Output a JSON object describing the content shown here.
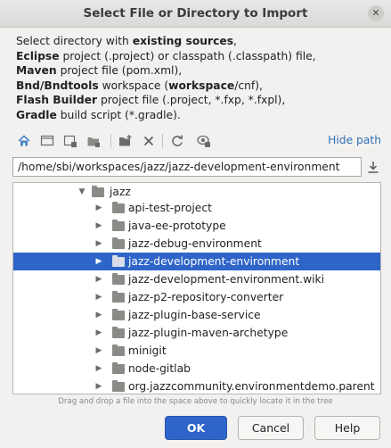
{
  "dialog": {
    "title": "Select File or Directory to Import"
  },
  "description": {
    "line1": {
      "pre": "Select directory with ",
      "bold": "existing sources",
      "post": ","
    },
    "line2": {
      "bold": "Eclipse",
      "post": " project (.project) or classpath (.classpath) file,"
    },
    "line3": {
      "bold": "Maven",
      "post": " project file (pom.xml),"
    },
    "line4": {
      "bold": "Bnd/Bndtools",
      "mid": " workspace (",
      "bold2": "workspace",
      "post": "/cnf),"
    },
    "line5": {
      "bold": "Flash Builder",
      "post": " project file (.project, *.fxp, *.fxpl),"
    },
    "line6": {
      "bold": "Gradle",
      "post": " build script (*.gradle)."
    }
  },
  "toolbar": {
    "icons": [
      "home-icon",
      "desktop-icon",
      "project-icon",
      "module-icon",
      "new-folder-icon",
      "delete-icon",
      "refresh-icon",
      "show-hidden-icon"
    ],
    "hide_path_label": "Hide path"
  },
  "path_field": {
    "value": "/home/sbi/workspaces/jazz/jazz-development-environment"
  },
  "tree": {
    "parent": {
      "label": "jazz",
      "expanded": true
    },
    "items": [
      {
        "label": "api-test-project"
      },
      {
        "label": "java-ee-prototype"
      },
      {
        "label": "jazz-debug-environment"
      },
      {
        "label": "jazz-development-environment",
        "selected": true
      },
      {
        "label": "jazz-development-environment.wiki"
      },
      {
        "label": "jazz-p2-repository-converter"
      },
      {
        "label": "jazz-plugin-base-service"
      },
      {
        "label": "jazz-plugin-maven-archetype"
      },
      {
        "label": "minigit"
      },
      {
        "label": "node-gitlab"
      },
      {
        "label": "org.jazzcommunity.environmentdemo.parent"
      }
    ],
    "hint": "Drag and drop a file into the space above to quickly locate it in the tree"
  },
  "buttons": {
    "ok": "OK",
    "cancel": "Cancel",
    "help": "Help"
  },
  "colors": {
    "accent": "#2f65c9",
    "link": "#2f6fb5",
    "folder": "#8c8a87"
  }
}
